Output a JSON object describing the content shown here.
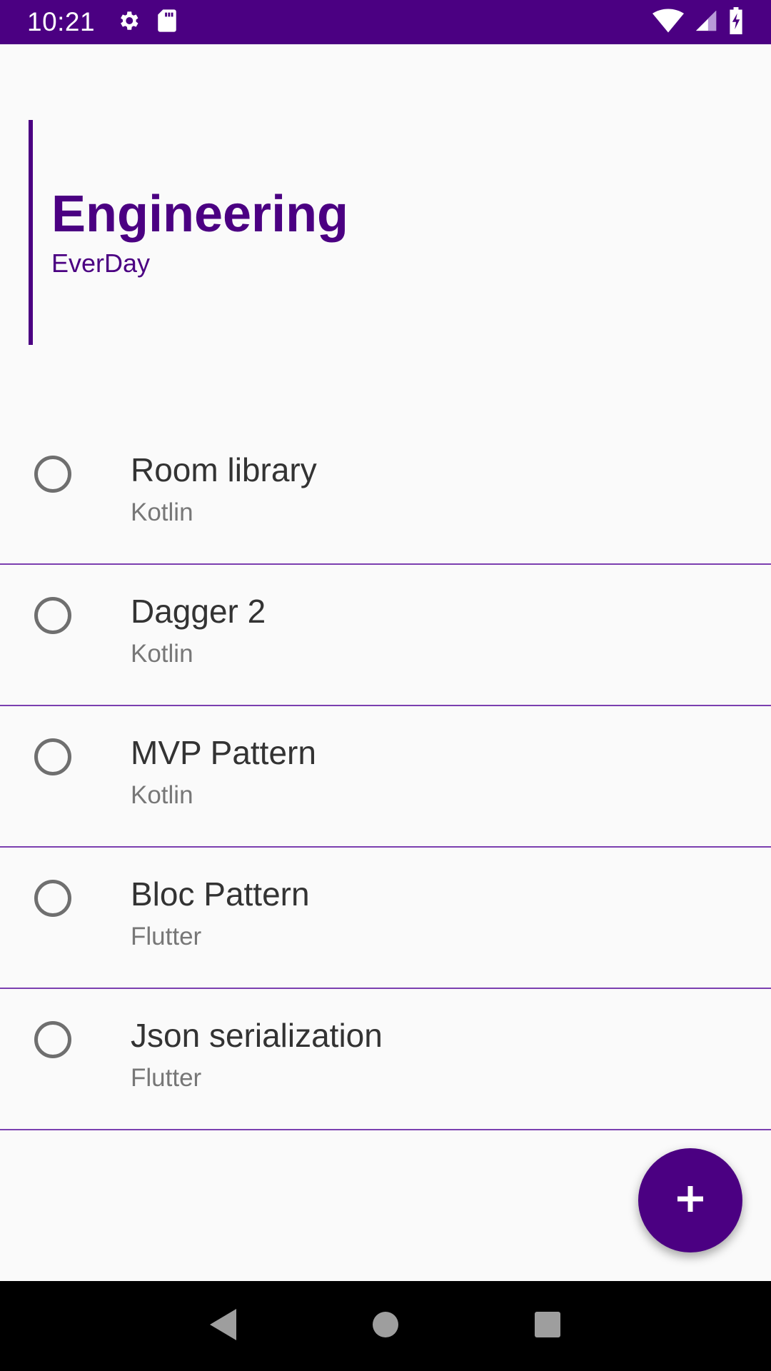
{
  "status_bar": {
    "time": "10:21",
    "icons_left": [
      "gear-icon",
      "sd-card-icon"
    ],
    "icons_right": [
      "wifi-icon",
      "cell-signal-icon",
      "battery-charging-icon"
    ]
  },
  "header": {
    "title": "Engineering",
    "subtitle": "EverDay"
  },
  "tasks": [
    {
      "title": "Room library",
      "subtitle": "Kotlin",
      "completed": false
    },
    {
      "title": "Dagger 2",
      "subtitle": "Kotlin",
      "completed": false
    },
    {
      "title": "MVP Pattern",
      "subtitle": "Kotlin",
      "completed": false
    },
    {
      "title": "Bloc Pattern",
      "subtitle": "Flutter",
      "completed": false
    },
    {
      "title": "Json serialization",
      "subtitle": "Flutter",
      "completed": false
    }
  ],
  "fab": {
    "icon": "plus-icon"
  },
  "nav_bar": {
    "icons": [
      "back-icon",
      "home-icon",
      "recents-icon"
    ]
  },
  "colors": {
    "primary": "#4b0082",
    "background": "#fafafa",
    "divider": "#7b3fb0"
  }
}
